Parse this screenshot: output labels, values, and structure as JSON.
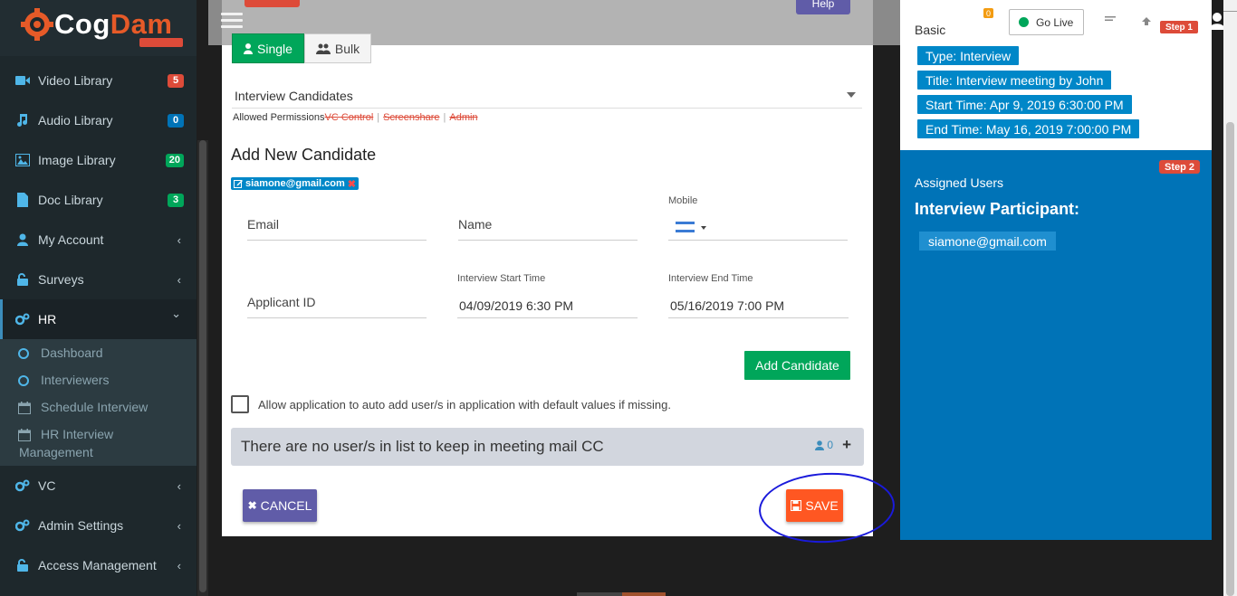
{
  "brand": {
    "logo_part1": "Cog",
    "logo_part2": "Dam"
  },
  "sidebar": {
    "items": [
      {
        "label": "Video Library",
        "badge": "5",
        "badge_color": "#dd4b39"
      },
      {
        "label": "Audio Library",
        "badge": "0",
        "badge_color": "#0073b7"
      },
      {
        "label": "Image Library",
        "badge": "20",
        "badge_color": "#00a65a"
      },
      {
        "label": "Doc Library",
        "badge": "3",
        "badge_color": "#00a65a"
      },
      {
        "label": "My Account",
        "chevron": "‹"
      },
      {
        "label": "Surveys",
        "chevron": "‹"
      },
      {
        "label": "HR",
        "chevron": "⌄"
      },
      {
        "label": "VC",
        "chevron": "‹"
      },
      {
        "label": "Admin Settings",
        "chevron": "‹"
      },
      {
        "label": "Access Management",
        "chevron": "‹"
      }
    ],
    "hr_sub": [
      {
        "label": "Dashboard"
      },
      {
        "label": "Interviewers"
      },
      {
        "label": "Schedule Interview"
      },
      {
        "label": "HR Interview",
        "label2": "Management"
      }
    ]
  },
  "modal": {
    "help_label": "Help",
    "tabs": {
      "single": "Single",
      "bulk": "Bulk"
    },
    "select_value": "Interview Candidates",
    "permissions": {
      "label": "Allowed Permissions",
      "items": [
        "VC Control",
        "Screenshare",
        "Admin"
      ]
    },
    "section_title": "Add New Candidate",
    "candidate_chip": "siamone@gmail.com",
    "form": {
      "email_label": "Email",
      "name_label": "Name",
      "mobile_label": "Mobile",
      "applicant_label": "Applicant ID",
      "start_label": "Interview Start Time",
      "start_value": "04/09/2019 6:30 PM",
      "end_label": "Interview End Time",
      "end_value": "05/16/2019 7:00 PM"
    },
    "add_candidate_label": "Add Candidate",
    "auto_add_label": "Allow application to auto add user/s in application with default values if missing.",
    "cc_text": "There are no user/s in list to keep in meeting mail CC",
    "cc_count": "0",
    "cancel_label": "CANCEL",
    "save_label": "SAVE"
  },
  "header": {
    "notification_count": "0",
    "go_live_label": "Go Live",
    "step_ribbon": "Step 1"
  },
  "summary": {
    "basic_label": "Basic",
    "tags": [
      "Type: Interview",
      "Title: Interview meeting by John",
      "Start Time: Apr 9, 2019 6:30:00 PM",
      "End Time: May 16, 2019 7:00:00 PM"
    ],
    "step2_label": "Step 2",
    "assigned_label": "Assigned Users",
    "participant_title": "Interview Participant:",
    "participants": [
      "siamone@gmail.com"
    ]
  },
  "colors": {
    "sidebar_bg": "#1e282c",
    "primary_blue": "#0073b7",
    "success_green": "#00a65a",
    "save_orange": "#ff5722",
    "cancel_purple": "#605ca8",
    "annotation_blue": "#1a1adb"
  }
}
